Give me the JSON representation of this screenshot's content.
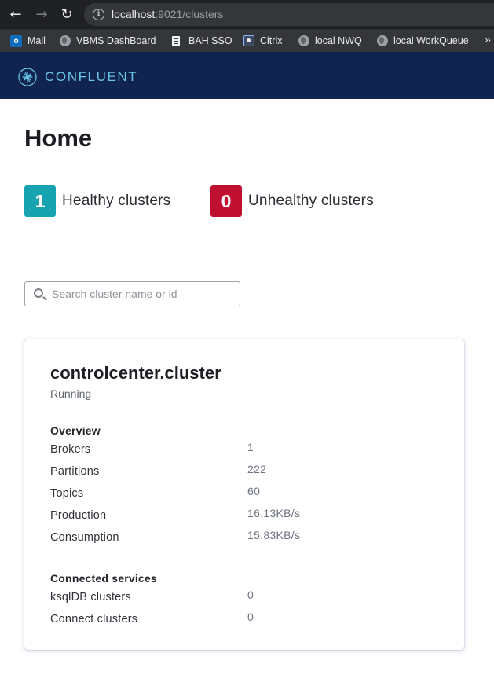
{
  "browser": {
    "url_host": "localhost",
    "url_path": ":9021/clusters",
    "bookmarks": [
      {
        "label": "Mail",
        "icon": "outlook-icon"
      },
      {
        "label": "VBMS DashBoard",
        "icon": "globe-icon"
      },
      {
        "label": "BAH SSO",
        "icon": "document-icon"
      },
      {
        "label": "Citrix",
        "icon": "citrix-icon"
      },
      {
        "label": "local NWQ",
        "icon": "globe-icon"
      },
      {
        "label": "local WorkQueue",
        "icon": "globe-icon"
      }
    ],
    "more_bookmarks": "»"
  },
  "header": {
    "brand": "CONFLUENT",
    "colors": {
      "background": "#10244f",
      "accent": "#69c5e6"
    }
  },
  "page": {
    "title": "Home",
    "healthy": {
      "count": "1",
      "label": "Healthy clusters",
      "color": "#18a3b0"
    },
    "unhealthy": {
      "count": "0",
      "label": "Unhealthy clusters",
      "color": "#bf1032"
    },
    "search": {
      "placeholder": "Search cluster name or id",
      "value": ""
    }
  },
  "cluster": {
    "name": "controlcenter.cluster",
    "status": "Running",
    "overview_title": "Overview",
    "overview": [
      {
        "label": "Brokers",
        "value": "1"
      },
      {
        "label": "Partitions",
        "value": "222"
      },
      {
        "label": "Topics",
        "value": "60"
      },
      {
        "label": "Production",
        "value": "16.13KB/s"
      },
      {
        "label": "Consumption",
        "value": "15.83KB/s"
      }
    ],
    "services_title": "Connected services",
    "services": [
      {
        "label": "ksqlDB clusters",
        "value": "0"
      },
      {
        "label": "Connect clusters",
        "value": "0"
      }
    ]
  }
}
